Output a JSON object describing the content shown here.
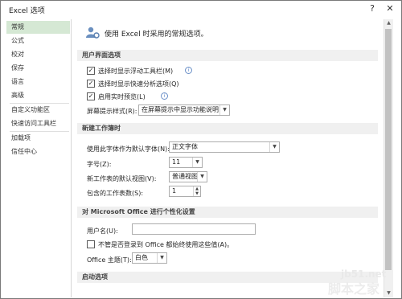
{
  "window": {
    "title": "Excel 选项",
    "help_icon": "?",
    "close_icon": "✕"
  },
  "sidebar": {
    "items": [
      {
        "label": "常规"
      },
      {
        "label": "公式"
      },
      {
        "label": "校对"
      },
      {
        "label": "保存"
      },
      {
        "label": "语言"
      },
      {
        "label": "高级"
      },
      {
        "label": "自定义功能区"
      },
      {
        "label": "快速访问工具栏"
      },
      {
        "label": "加载项"
      },
      {
        "label": "信任中心"
      }
    ]
  },
  "intro": {
    "text": "使用 Excel 时采用的常规选项。"
  },
  "sections": {
    "ui": "用户界面选项",
    "new_workbook": "新建工作簿时",
    "personalize": "对 Microsoft Office 进行个性化设置",
    "startup": "启动选项"
  },
  "ui_options": {
    "mini_toolbar": {
      "label": "选择时显示浮动工具栏(M)",
      "checked": "✓"
    },
    "quick_analysis": {
      "label": "选择时显示快速分析选项(Q)",
      "checked": "✓"
    },
    "live_preview": {
      "label": "启用实时预览(L)",
      "checked": "✓"
    },
    "screentip_label": "屏幕提示样式(R):",
    "screentip_value": "在屏幕提示中显示功能说明"
  },
  "new_wb": {
    "font_label": "使用此字体作为默认字体(N):",
    "font_value": "正文字体",
    "size_label": "字号(Z):",
    "size_value": "11",
    "view_label": "新工作表的默认视图(V):",
    "view_value": "普通视图",
    "sheets_label": "包含的工作表数(S):",
    "sheets_value": "1"
  },
  "personal": {
    "username_label": "用户名(U):",
    "username_value": "",
    "always_use_label": "不管是否登录到 Office 都始终使用这些值(A)。",
    "theme_label": "Office 主题(T):",
    "theme_value": "白色"
  },
  "watermark": {
    "site": "jb51.net",
    "name": "脚本之家"
  }
}
